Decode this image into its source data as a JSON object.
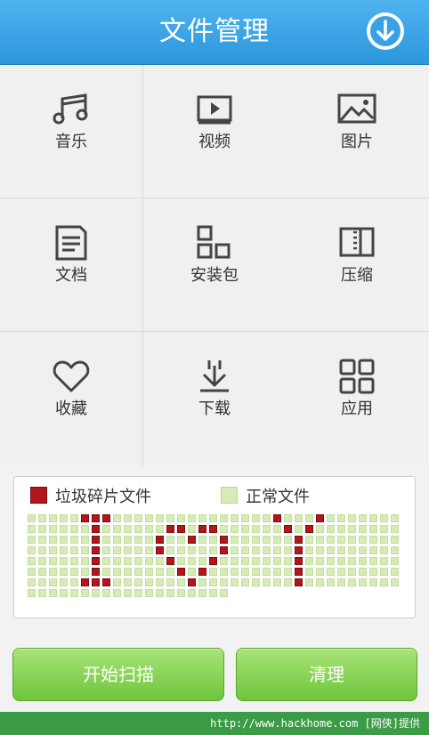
{
  "header": {
    "title": "文件管理",
    "download_icon": "download-circle-icon"
  },
  "categories": [
    {
      "label": "音乐",
      "icon": "music-note-icon"
    },
    {
      "label": "视频",
      "icon": "video-play-icon"
    },
    {
      "label": "图片",
      "icon": "picture-icon"
    },
    {
      "label": "文档",
      "icon": "document-icon"
    },
    {
      "label": "安装包",
      "icon": "package-icon"
    },
    {
      "label": "压缩",
      "icon": "archive-icon"
    },
    {
      "label": "收藏",
      "icon": "heart-icon"
    },
    {
      "label": "下载",
      "icon": "download-arrow-icon"
    },
    {
      "label": "应用",
      "icon": "apps-grid-icon"
    }
  ],
  "legend": {
    "junk_label": "垃圾碎片文件",
    "normal_label": "正常文件",
    "junk_color": "#b3151d",
    "normal_color": "#d6ecb8"
  },
  "actions": {
    "scan_label": "开始扫描",
    "clean_label": "清理"
  },
  "footer": {
    "watermark": "http://www.hackhome.com [网侠]提供"
  }
}
